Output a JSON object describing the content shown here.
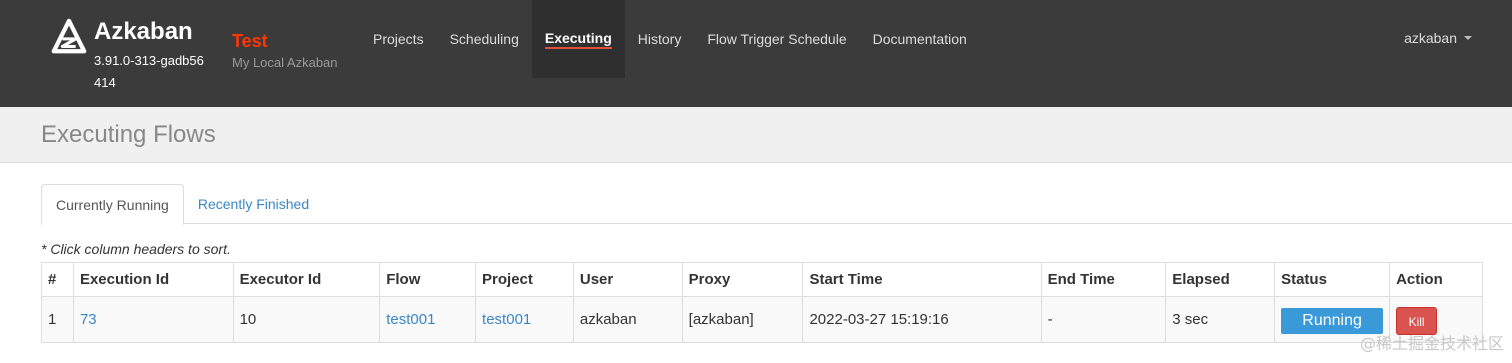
{
  "brand": {
    "name": "Azkaban",
    "version": "3.91.0-313-gadb56414",
    "logo_icon": "azkaban-logo-icon"
  },
  "environment": {
    "name": "Test",
    "description": "My Local Azkaban",
    "color": "#ff3601"
  },
  "nav": {
    "items": [
      {
        "label": "Projects"
      },
      {
        "label": "Scheduling"
      },
      {
        "label": "Executing"
      },
      {
        "label": "History"
      },
      {
        "label": "Flow Trigger Schedule"
      },
      {
        "label": "Documentation"
      }
    ],
    "active": "Executing"
  },
  "user_menu": {
    "label": "azkaban",
    "icon": "caret-down-icon"
  },
  "page": {
    "title": "Executing Flows"
  },
  "tabs": {
    "items": [
      {
        "label": "Currently Running"
      },
      {
        "label": "Recently Finished"
      }
    ],
    "active": "Currently Running"
  },
  "hint": "* Click column headers to sort.",
  "table": {
    "columns": [
      "#",
      "Execution Id",
      "Executor Id",
      "Flow",
      "Project",
      "User",
      "Proxy",
      "Start Time",
      "End Time",
      "Elapsed",
      "Status",
      "Action"
    ],
    "rows": [
      {
        "num": "1",
        "execution_id": "73",
        "executor_id": "10",
        "flow": "test001",
        "project": "test001",
        "user": "azkaban",
        "proxy": "[azkaban]",
        "start_time": "2022-03-27 15:19:16",
        "end_time": "-",
        "elapsed": "3 sec",
        "status": "Running",
        "action": "Kill"
      }
    ]
  },
  "colors": {
    "navbar_bg": "#3b3b3b",
    "link": "#3a87c8",
    "status_running": "#3a9ad9",
    "kill_button": "#d9534f"
  },
  "watermark": "@稀土掘金技术社区"
}
